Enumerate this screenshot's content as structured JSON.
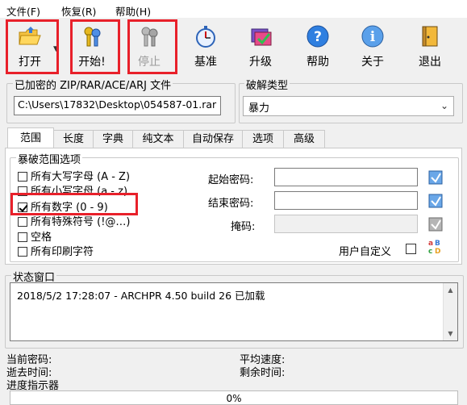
{
  "menu": {
    "file": "文件(F)",
    "recover": "恢复(R)",
    "help": "帮助(H)"
  },
  "toolbar": {
    "open": "打开",
    "start": "开始!",
    "stop": "停止",
    "benchmark": "基准",
    "upgrade": "升级",
    "help": "帮助",
    "about": "关于",
    "exit": "退出"
  },
  "encrypted_file": {
    "group_title": "已加密的 ZIP/RAR/ACE/ARJ 文件",
    "path": "C:\\Users\\17832\\Desktop\\054587-01.rar"
  },
  "attack_type": {
    "group_title": "破解类型",
    "selected": "暴力"
  },
  "tabs": [
    "范围",
    "长度",
    "字典",
    "纯文本",
    "自动保存",
    "选项",
    "高级"
  ],
  "range": {
    "group_title": "暴破范围选项",
    "options": [
      {
        "label": "所有大写字母 (A - Z)",
        "checked": false
      },
      {
        "label": "所有小写字母 (a - z)",
        "checked": false
      },
      {
        "label": "所有数字 (0 - 9)",
        "checked": true
      },
      {
        "label": "所有特殊符号 (!@…)",
        "checked": false
      },
      {
        "label": "空格",
        "checked": false
      },
      {
        "label": "所有印刷字符",
        "checked": false
      }
    ],
    "start_password_label": "起始密码:",
    "start_password": "",
    "end_password_label": "结束密码:",
    "end_password": "",
    "mask_label": "掩码:",
    "mask": "",
    "user_defined_label": "用户自定义"
  },
  "status": {
    "group_title": "状态窗口",
    "log": "2018/5/2 17:28:07 - ARCHPR 4.50 build 26 已加载"
  },
  "info": {
    "current_password": "当前密码:",
    "elapsed_time": "逝去时间:",
    "avg_speed": "平均速度:",
    "remaining_time": "剩余时间:",
    "progress_indicator": "进度指示器"
  },
  "progress": {
    "text": "0%",
    "fraction": 0
  },
  "colors": {
    "highlight_box": "#e8202a",
    "progress_fill": "#06b025"
  }
}
